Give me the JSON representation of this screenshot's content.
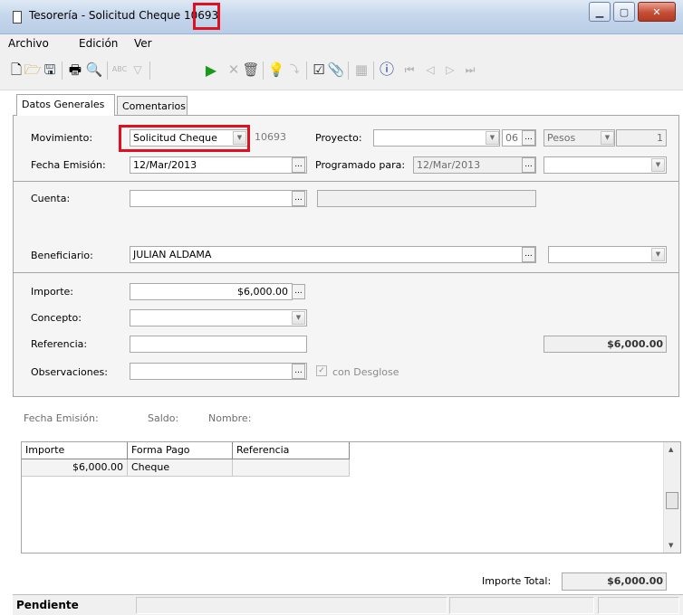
{
  "window": {
    "title": "Tesorería - Solicitud Cheque 10693"
  },
  "menu": [
    "Archivo",
    "Edición",
    "Ver"
  ],
  "tabs": [
    "Datos Generales",
    "Comentarios"
  ],
  "form": {
    "movimiento_label": "Movimiento:",
    "movimiento_value": "Solicitud Cheque",
    "mov_id": "10693",
    "proyecto_label": "Proyecto:",
    "proyecto_value": "",
    "periodo": "06",
    "moneda": "Pesos",
    "tipo_cambio": "1",
    "fecha_emision_label": "Fecha Emisión:",
    "fecha_emision_value": "12/Mar/2013",
    "programado_label": "Programado para:",
    "programado_value": "12/Mar/2013",
    "cuenta_label": "Cuenta:",
    "cuenta_value": "",
    "beneficiario_label": "Beneficiario:",
    "beneficiario_value": "JULIAN ALDAMA",
    "importe_label": "Importe:",
    "importe_value": "$6,000.00",
    "concepto_label": "Concepto:",
    "concepto_value": "",
    "referencia_label": "Referencia:",
    "referencia_value": "",
    "observaciones_label": "Observaciones:",
    "observaciones_value": "",
    "con_desglose_label": "con Desglose",
    "total_right": "$6,000.00"
  },
  "info": {
    "fecha_emision": "Fecha Emisión:",
    "saldo": "Saldo:",
    "nombre": "Nombre:"
  },
  "grid": {
    "columns": [
      "Importe",
      "Forma Pago",
      "Referencia"
    ],
    "rows": [
      {
        "importe": "$6,000.00",
        "forma_pago": "Cheque",
        "referencia": ""
      }
    ]
  },
  "footer": {
    "importe_total_label": "Importe Total:",
    "importe_total_value": "$6,000.00"
  },
  "status": {
    "estatus": "Pendiente"
  },
  "colors": {
    "highlight": "#e01020",
    "titlebar": "#c6d7ec",
    "play": "#1a9a1a",
    "info": "#1a2f8c"
  }
}
